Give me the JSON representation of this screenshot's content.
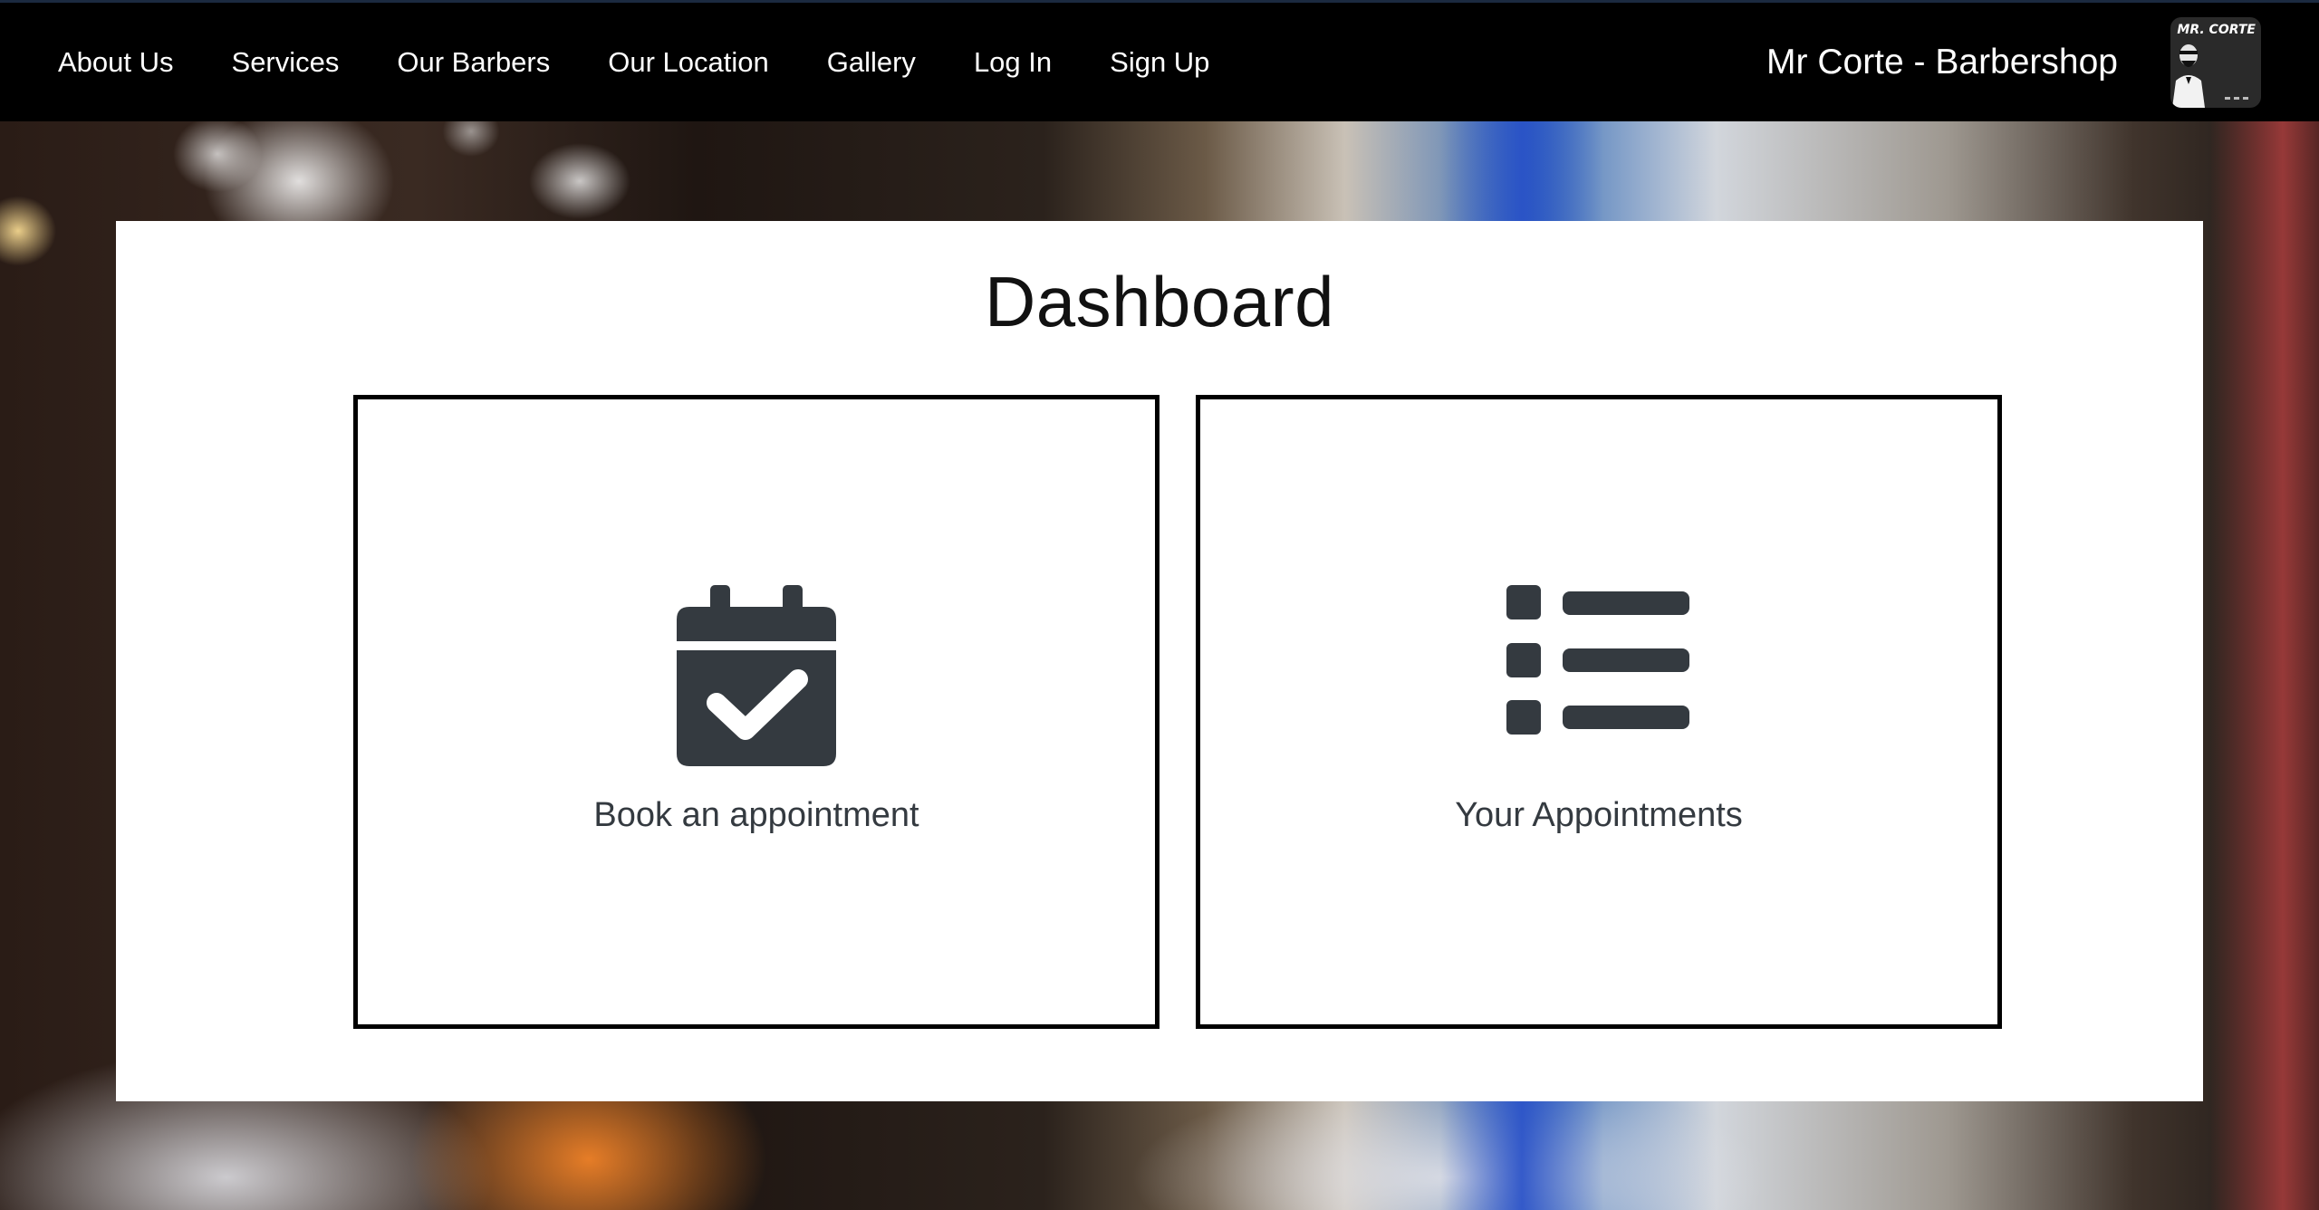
{
  "nav": {
    "links": [
      {
        "label": "About Us"
      },
      {
        "label": "Services"
      },
      {
        "label": "Our Barbers"
      },
      {
        "label": "Our Location"
      },
      {
        "label": "Gallery"
      },
      {
        "label": "Log In"
      },
      {
        "label": "Sign Up"
      }
    ],
    "brand_name": "Mr Corte - Barbershop",
    "logo_text": "MR. CORTE"
  },
  "main": {
    "title": "Dashboard",
    "cards": [
      {
        "label": "Book an appointment",
        "icon": "calendar-check-icon"
      },
      {
        "label": "Your Appointments",
        "icon": "list-icon"
      }
    ]
  },
  "colors": {
    "navbar_bg": "#000000",
    "icon_color": "#343a40",
    "card_border": "#000000"
  }
}
